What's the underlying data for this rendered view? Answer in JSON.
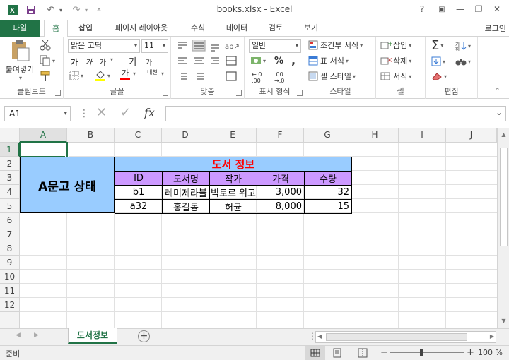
{
  "title_bar": {
    "title": "books.xlsx - Excel",
    "help": "?",
    "minimize": "—",
    "restore": "❐",
    "close": "✕"
  },
  "tabs": {
    "file": "파일",
    "items": [
      "홈",
      "삽입",
      "페이지 레이아웃",
      "수식",
      "데이터",
      "검토",
      "보기"
    ],
    "active": "홈",
    "login": "로그인"
  },
  "ribbon": {
    "clipboard": {
      "label": "클립보드",
      "paste": "붙여넣기"
    },
    "font": {
      "label": "글꼴",
      "font_name": "맑은 고딕",
      "font_size": "11",
      "bold": "가",
      "italic": "가",
      "underline": "가",
      "grow": "가",
      "shrink": "가",
      "color_a": "가",
      "phonetic": "내천"
    },
    "alignment": {
      "label": "맞춤"
    },
    "number": {
      "label": "표시 형식",
      "format": "일반",
      "percent": "%",
      "comma": ","
    },
    "styles": {
      "label": "스타일",
      "conditional": "조건부 서식",
      "table": "표 서식",
      "cell_style": "셀 스타일"
    },
    "cells": {
      "label": "셀",
      "insert": "삽입",
      "delete": "삭제",
      "format": "서식"
    },
    "editing": {
      "label": "편집",
      "sum": "Σ",
      "sort": "정렬",
      "find": "찾기"
    }
  },
  "formula_bar": {
    "name_box": "A1",
    "fx": "fx",
    "cancel": "✕",
    "enter": "✓",
    "value": ""
  },
  "grid": {
    "columns": [
      "A",
      "B",
      "C",
      "D",
      "E",
      "F",
      "G",
      "H",
      "I",
      "J"
    ],
    "rows": [
      "1",
      "2",
      "3",
      "4",
      "5",
      "6",
      "7",
      "8",
      "9",
      "10",
      "11",
      "12"
    ],
    "selected_column": "A",
    "selected_row": "1"
  },
  "sheet": {
    "merged_label": "A문고 상태",
    "table_title": "도서 정보",
    "headers": [
      "ID",
      "도서명",
      "작가",
      "가격",
      "수량"
    ],
    "rows": [
      [
        "b1",
        "레미제라블",
        "빅토르 위고",
        "3,000",
        "32"
      ],
      [
        "a32",
        "홍길동",
        "허균",
        "8,000",
        "15"
      ]
    ]
  },
  "sheet_tabs": {
    "active": "도서정보",
    "add": "+"
  },
  "status": {
    "ready": "준비",
    "zoom": "100 %",
    "minus": "−",
    "plus": "+"
  },
  "colors": {
    "brand": "#217346",
    "merged_fill": "#99ccff",
    "header_fill": "#cc99ff",
    "title_color": "#ff0000"
  }
}
